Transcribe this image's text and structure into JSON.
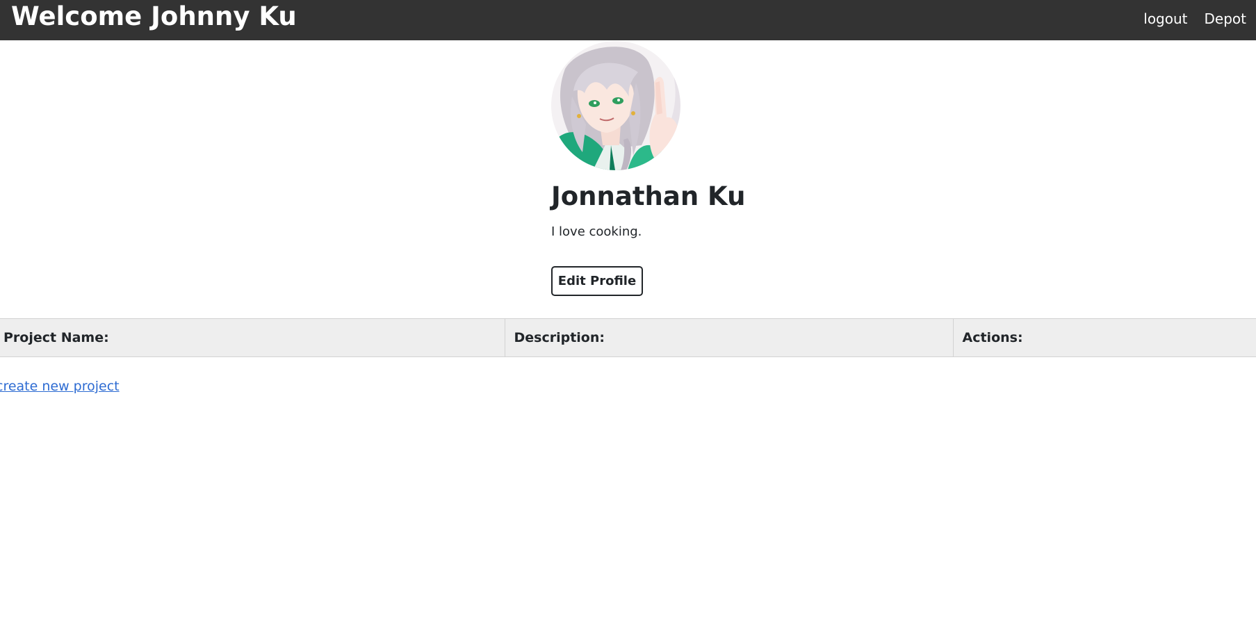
{
  "navbar": {
    "brand": "Welcome Johnny Ku",
    "links": [
      {
        "label": "logout"
      },
      {
        "label": "Depot"
      }
    ]
  },
  "profile": {
    "avatar_alt": "anime character avatar",
    "name": "Jonnathan Ku",
    "bio": "I love cooking.",
    "edit_button_label": "Edit Profile"
  },
  "projects_table": {
    "columns": [
      "Project Name:",
      "Description:",
      "Actions:"
    ],
    "rows": []
  },
  "create_project_link": "create new project",
  "colors": {
    "navbar_bg": "#333333",
    "table_header_bg": "#eeeeee",
    "link": "#2d6bd2",
    "text": "#212529"
  }
}
